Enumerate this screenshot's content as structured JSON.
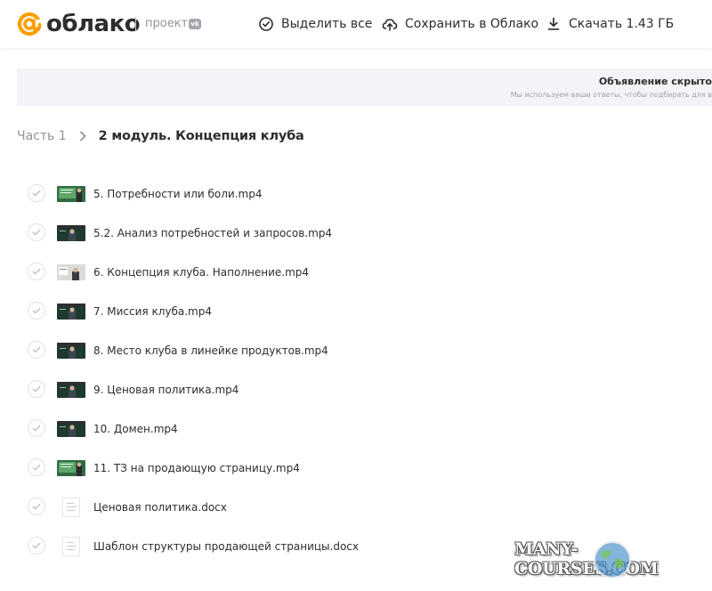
{
  "header": {
    "logo_text": "облако",
    "project_label": "проект",
    "vk_badge": "vk",
    "actions": [
      {
        "label": "Выделить все",
        "icon": "check-circle-icon"
      },
      {
        "label": "Сохранить в Облако",
        "icon": "cloud-upload-icon"
      },
      {
        "label": "Скачать 1.43 ГБ",
        "icon": "download-icon"
      }
    ]
  },
  "ad": {
    "title": "Объявление скрыто",
    "subtitle": "Мы используем ваши ответы, чтобы подбирать для в"
  },
  "breadcrumb": {
    "parent": "Часть 1",
    "current": "2 модуль. Концепция клуба"
  },
  "files": [
    {
      "name": "5. Потребности или боли.mp4",
      "type": "video",
      "thumb": "green-board"
    },
    {
      "name": "5.2. Анализ потребностей и запросов.mp4",
      "type": "video",
      "thumb": "dark-board"
    },
    {
      "name": "6. Концепция клуба. Наполнение.mp4",
      "type": "video",
      "thumb": "light-room"
    },
    {
      "name": "7. Миссия клуба.mp4",
      "type": "video",
      "thumb": "dark-board"
    },
    {
      "name": "8. Место клуба в линейке продуктов.mp4",
      "type": "video",
      "thumb": "dark-board"
    },
    {
      "name": "9. Ценовая политика.mp4",
      "type": "video",
      "thumb": "dark-board"
    },
    {
      "name": "10. Домен.mp4",
      "type": "video",
      "thumb": "dark-board"
    },
    {
      "name": "11. ТЗ на продающую страницу.mp4",
      "type": "video",
      "thumb": "green-board"
    },
    {
      "name": "Ценовая политика.docx",
      "type": "document",
      "thumb": "doc"
    },
    {
      "name": "Шаблон структуры продающей страницы.docx",
      "type": "document",
      "thumb": "doc"
    }
  ],
  "watermark": "MANY-COURSES.COM",
  "colors": {
    "brand_orange": "#FF9E00",
    "text": "#2C2D2E",
    "muted": "#919399",
    "ad_bg": "#F3F4F7"
  }
}
